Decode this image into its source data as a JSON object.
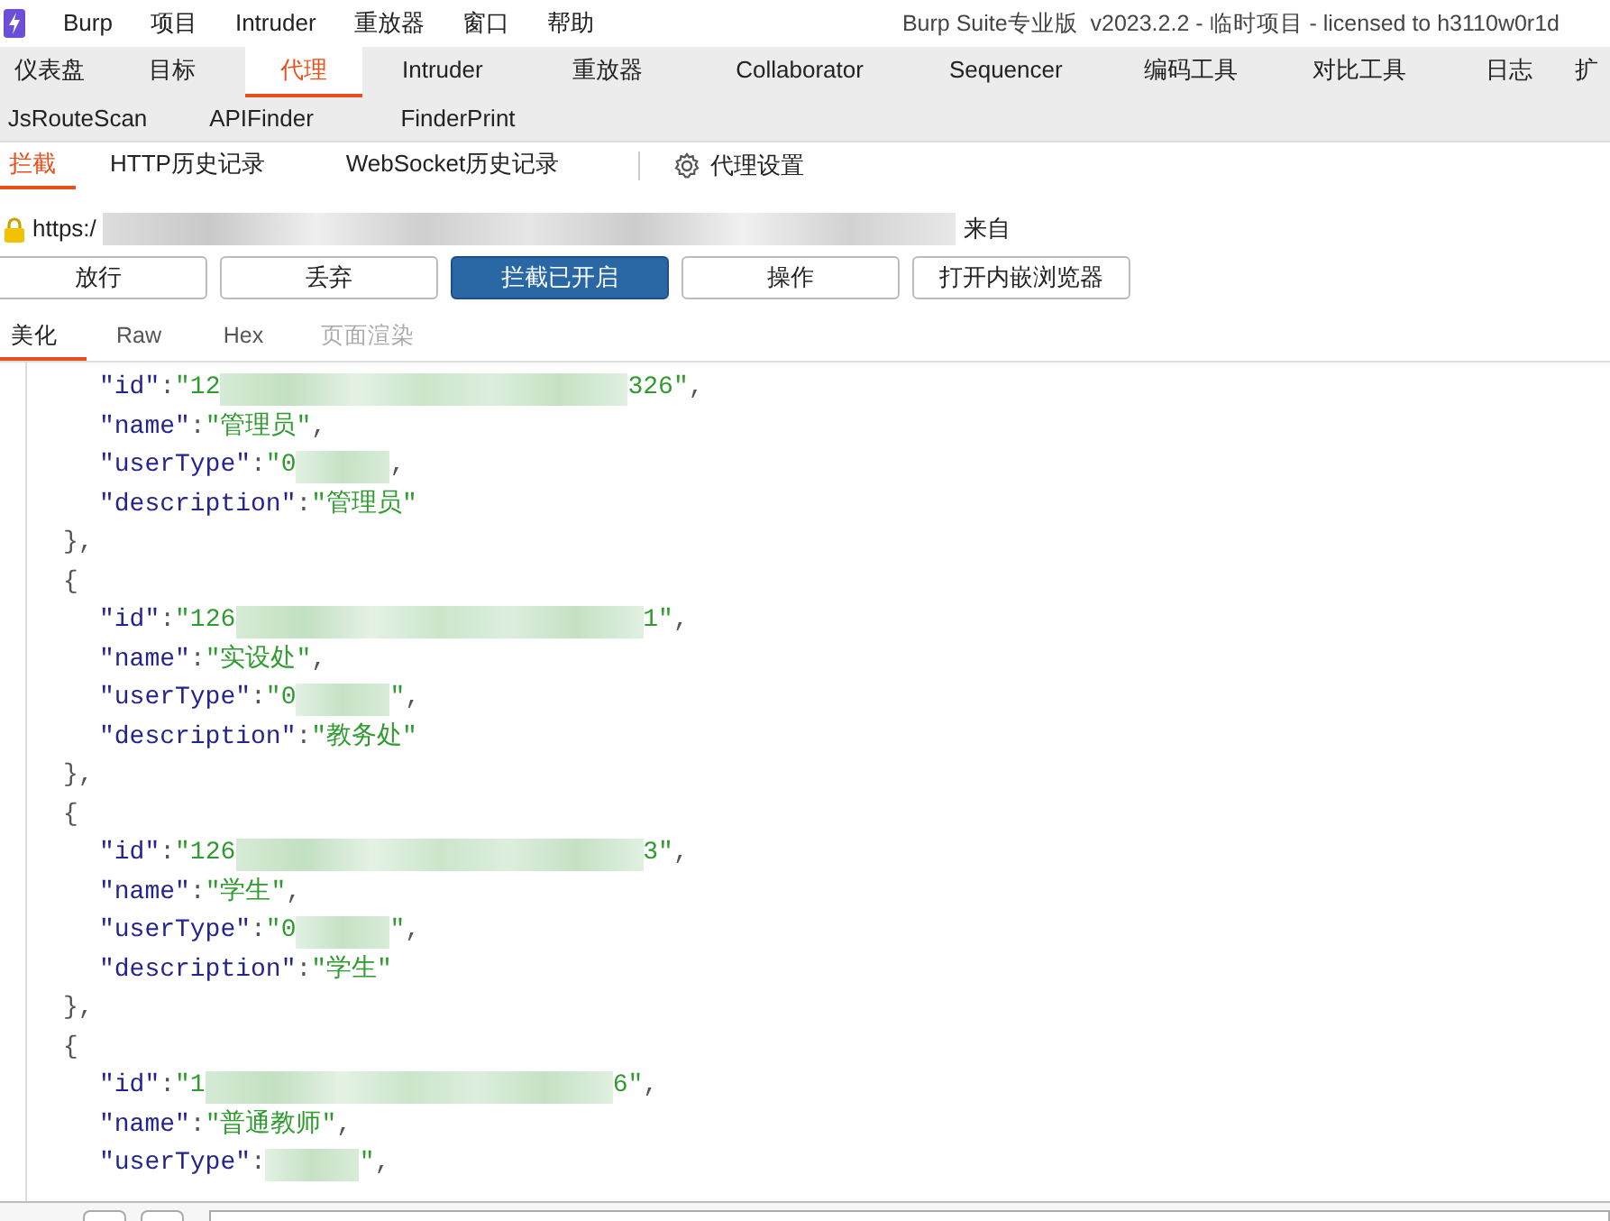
{
  "menu_bar": {
    "items": [
      "Burp",
      "项目",
      "Intruder",
      "重放器",
      "窗口",
      "帮助"
    ],
    "title": "Burp Suite专业版  v2023.2.2 - 临时项目 - licensed to h3110w0r1d"
  },
  "main_tabs": [
    {
      "label": "仪表盘",
      "selected": false
    },
    {
      "label": "目标",
      "selected": false
    },
    {
      "label": "代理",
      "selected": true
    },
    {
      "label": "Intruder",
      "selected": false
    },
    {
      "label": "重放器",
      "selected": false
    },
    {
      "label": "Collaborator",
      "selected": false
    },
    {
      "label": "Sequencer",
      "selected": false
    },
    {
      "label": "编码工具",
      "selected": false
    },
    {
      "label": "对比工具",
      "selected": false
    },
    {
      "label": "日志",
      "selected": false
    },
    {
      "label": "扩",
      "selected": false
    }
  ],
  "extension_tabs": [
    {
      "label": "JsRouteScan",
      "selected": false
    },
    {
      "label": "APIFinder",
      "selected": false
    },
    {
      "label": "FinderPrint",
      "selected": false
    }
  ],
  "proxy_tabs": [
    {
      "label": "拦截",
      "selected": true
    },
    {
      "label": "HTTP历史记录",
      "selected": false
    },
    {
      "label": "WebSocket历史记录",
      "selected": false
    }
  ],
  "proxy_settings": "代理设置",
  "request_bar": {
    "url_prefix": "https:/",
    "url_suffix": "来自"
  },
  "buttons": [
    {
      "label": "放行",
      "selected": false
    },
    {
      "label": "丢弃",
      "selected": false
    },
    {
      "label": "拦截已开启",
      "selected": true
    },
    {
      "label": "操作",
      "selected": false
    },
    {
      "label": "打开内嵌浏览器",
      "selected": false
    }
  ],
  "editor_tabs": [
    {
      "label": "美化",
      "selected": true,
      "disabled": false
    },
    {
      "label": "Raw",
      "selected": false,
      "disabled": false
    },
    {
      "label": "Hex",
      "selected": false,
      "disabled": false
    },
    {
      "label": "页面渲染",
      "selected": false,
      "disabled": true
    }
  ],
  "code_lines": [
    {
      "kind": "field",
      "tokens": [
        {
          "kind": "key",
          "text": "\"id\""
        },
        {
          "kind": "punct",
          "text": ":"
        },
        {
          "kind": "string",
          "text": "\"12"
        },
        {
          "kind": "redacted_long"
        },
        {
          "kind": "string",
          "text": "326\""
        },
        {
          "kind": "punct",
          "text": ","
        }
      ]
    },
    {
      "kind": "field",
      "tokens": [
        {
          "kind": "key",
          "text": "\"name\""
        },
        {
          "kind": "punct",
          "text": ":"
        },
        {
          "kind": "string",
          "text": "\"管理员\""
        },
        {
          "kind": "punct",
          "text": ","
        }
      ]
    },
    {
      "kind": "field",
      "tokens": [
        {
          "kind": "key",
          "text": "\"userType\""
        },
        {
          "kind": "punct",
          "text": ":"
        },
        {
          "kind": "string",
          "text": "\"0"
        },
        {
          "kind": "redacted_short"
        },
        {
          "kind": "punct",
          "text": ","
        }
      ]
    },
    {
      "kind": "field",
      "tokens": [
        {
          "kind": "key",
          "text": "\"description\""
        },
        {
          "kind": "punct",
          "text": ":"
        },
        {
          "kind": "string",
          "text": "\"管理员\""
        }
      ]
    },
    {
      "kind": "brace",
      "tokens": [
        {
          "kind": "punct",
          "text": "},"
        }
      ]
    },
    {
      "kind": "brace",
      "tokens": [
        {
          "kind": "punct",
          "text": "{"
        }
      ]
    },
    {
      "kind": "field",
      "tokens": [
        {
          "kind": "key",
          "text": "\"id\""
        },
        {
          "kind": "punct",
          "text": ":"
        },
        {
          "kind": "string",
          "text": "\"126"
        },
        {
          "kind": "redacted_long"
        },
        {
          "kind": "string",
          "text": "1\""
        },
        {
          "kind": "punct",
          "text": ","
        }
      ]
    },
    {
      "kind": "field",
      "tokens": [
        {
          "kind": "key",
          "text": "\"name\""
        },
        {
          "kind": "punct",
          "text": ":"
        },
        {
          "kind": "string",
          "text": "\"实设处\""
        },
        {
          "kind": "punct",
          "text": ","
        }
      ]
    },
    {
      "kind": "field",
      "tokens": [
        {
          "kind": "key",
          "text": "\"userType\""
        },
        {
          "kind": "punct",
          "text": ":"
        },
        {
          "kind": "string",
          "text": "\"0"
        },
        {
          "kind": "redacted_short"
        },
        {
          "kind": "string",
          "text": "\""
        },
        {
          "kind": "punct",
          "text": ","
        }
      ]
    },
    {
      "kind": "field",
      "tokens": [
        {
          "kind": "key",
          "text": "\"description\""
        },
        {
          "kind": "punct",
          "text": ":"
        },
        {
          "kind": "string",
          "text": "\"教务处\""
        }
      ]
    },
    {
      "kind": "brace",
      "tokens": [
        {
          "kind": "punct",
          "text": "},"
        }
      ]
    },
    {
      "kind": "brace",
      "tokens": [
        {
          "kind": "punct",
          "text": "{"
        }
      ]
    },
    {
      "kind": "field",
      "tokens": [
        {
          "kind": "key",
          "text": "\"id\""
        },
        {
          "kind": "punct",
          "text": ":"
        },
        {
          "kind": "string",
          "text": "\"126"
        },
        {
          "kind": "redacted_long"
        },
        {
          "kind": "string",
          "text": "3\""
        },
        {
          "kind": "punct",
          "text": ","
        }
      ]
    },
    {
      "kind": "field",
      "tokens": [
        {
          "kind": "key",
          "text": "\"name\""
        },
        {
          "kind": "punct",
          "text": ":"
        },
        {
          "kind": "string",
          "text": "\"学生\""
        },
        {
          "kind": "punct",
          "text": ","
        }
      ]
    },
    {
      "kind": "field",
      "tokens": [
        {
          "kind": "key",
          "text": "\"userType\""
        },
        {
          "kind": "punct",
          "text": ":"
        },
        {
          "kind": "string",
          "text": "\"0"
        },
        {
          "kind": "redacted_short"
        },
        {
          "kind": "string",
          "text": "\""
        },
        {
          "kind": "punct",
          "text": ","
        }
      ]
    },
    {
      "kind": "field",
      "tokens": [
        {
          "kind": "key",
          "text": "\"description\""
        },
        {
          "kind": "punct",
          "text": ":"
        },
        {
          "kind": "string",
          "text": "\"学生\""
        }
      ]
    },
    {
      "kind": "brace",
      "tokens": [
        {
          "kind": "punct",
          "text": "},"
        }
      ]
    },
    {
      "kind": "brace",
      "tokens": [
        {
          "kind": "punct",
          "text": "{"
        }
      ]
    },
    {
      "kind": "field",
      "tokens": [
        {
          "kind": "key",
          "text": "\"id\""
        },
        {
          "kind": "punct",
          "text": ":"
        },
        {
          "kind": "string",
          "text": "\"1"
        },
        {
          "kind": "redacted_long"
        },
        {
          "kind": "string",
          "text": "6\""
        },
        {
          "kind": "punct",
          "text": ","
        }
      ]
    },
    {
      "kind": "field",
      "tokens": [
        {
          "kind": "key",
          "text": "\"name\""
        },
        {
          "kind": "punct",
          "text": ":"
        },
        {
          "kind": "string",
          "text": "\"普通教师\""
        },
        {
          "kind": "punct",
          "text": ","
        }
      ]
    },
    {
      "kind": "field",
      "tokens": [
        {
          "kind": "key",
          "text": "\"userType\""
        },
        {
          "kind": "punct",
          "text": ":"
        },
        {
          "kind": "redacted_short"
        },
        {
          "kind": "string",
          "text": "\""
        },
        {
          "kind": "punct",
          "text": ","
        }
      ]
    }
  ]
}
